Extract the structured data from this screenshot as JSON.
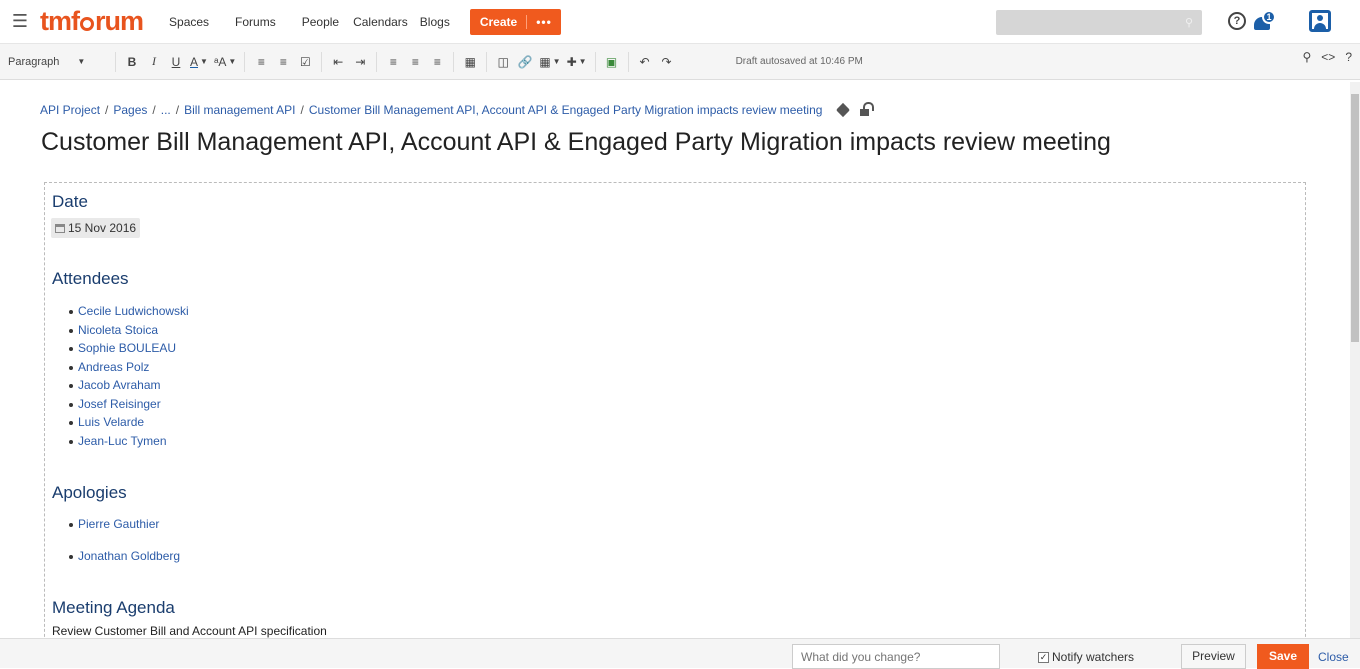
{
  "brand": {
    "logo_pre": "tmf",
    "logo_post": "rum"
  },
  "nav": {
    "spaces": "Spaces",
    "forums": "Forums",
    "people": "People",
    "calendars": "Calendars",
    "blogs": "Blogs",
    "create": "Create",
    "more": "•••"
  },
  "header": {
    "help_icon": "?",
    "notif_count": "1"
  },
  "toolbar": {
    "paragraph": "Paragraph",
    "bold": "B",
    "italic": "I",
    "underline": "U",
    "color": "A",
    "draft_status": "Draft autosaved at 10:46 PM"
  },
  "breadcrumb": {
    "items": [
      "API Project",
      "Pages",
      "...",
      "Bill management API",
      "Customer Bill Management API, Account API & Engaged Party Migration impacts review meeting"
    ]
  },
  "page_title": "Customer Bill Management API, Account API & Engaged Party Migration impacts review meeting",
  "content": {
    "date_heading": "Date",
    "date_value": "15 Nov 2016",
    "attendees_heading": "Attendees",
    "attendees": [
      "Cecile Ludwichowski",
      "Nicoleta Stoica",
      "Sophie BOULEAU",
      "Andreas Polz",
      "Jacob Avraham",
      "Josef Reisinger",
      "Luis Velarde",
      "Jean-Luc Tymen"
    ],
    "apologies_heading": "Apologies",
    "apologies": [
      "Pierre Gauthier",
      "Jonathan Goldberg"
    ],
    "agenda_heading": "Meeting Agenda",
    "agenda_text": "Review  Customer Bill and Account API specification"
  },
  "footer": {
    "change_placeholder": "What did you change?",
    "notify_label": "Notify watchers",
    "notify_checked": true,
    "preview": "Preview",
    "save": "Save",
    "close": "Close"
  },
  "colors": {
    "accent": "#f05a1e",
    "link": "#2d5ca8",
    "heading": "#1a3d6e"
  }
}
